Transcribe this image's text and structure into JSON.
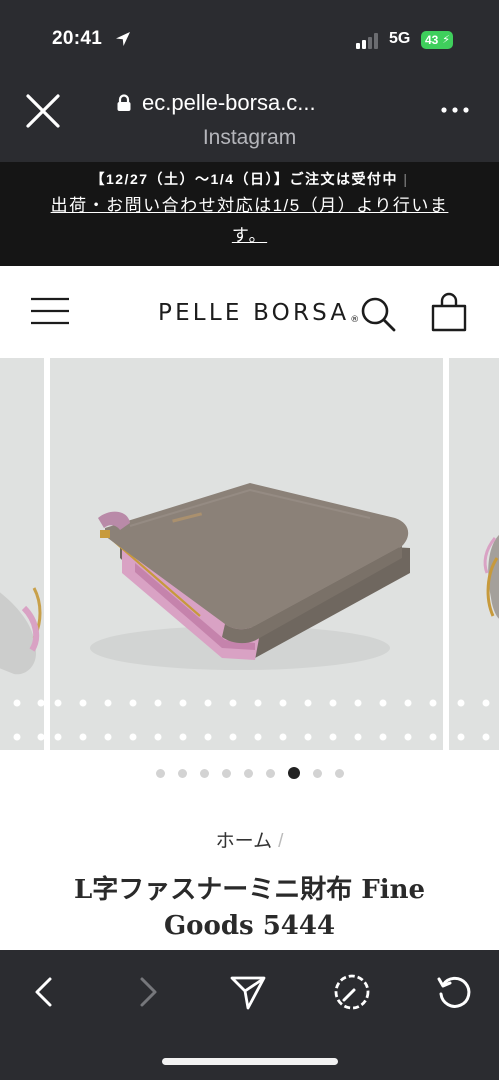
{
  "status_bar": {
    "time": "20:41",
    "network": "5G",
    "battery": "43",
    "icons": [
      "location-arrow-icon",
      "signal-bars-icon",
      "battery-charging-icon"
    ]
  },
  "browser": {
    "url": "ec.pelle-borsa.c...",
    "subtitle": "Instagram",
    "icons": [
      "close-icon",
      "lock-icon",
      "more-dots-icon"
    ]
  },
  "notice": {
    "line1": "【12/27（土）～1/4（日）】ご注文は受付中",
    "separator": "|",
    "line2": "出荷・お問い合わせ対応は1/5（月）より行います。"
  },
  "site_header": {
    "brand": "PELLE BORSA",
    "brand_mark": "®",
    "icons": [
      "hamburger-menu-icon",
      "search-icon",
      "shopping-bag-icon"
    ]
  },
  "gallery": {
    "slide_count": 9,
    "active_index": 6
  },
  "breadcrumb": {
    "home": "ホーム",
    "separator": "/"
  },
  "product": {
    "title_line1": "L字ファスナーミニ財布 Fine",
    "title_line2": "Goods 5444"
  },
  "toolbar": {
    "icons": [
      "chevron-left-icon",
      "chevron-right-icon",
      "send-icon",
      "compass-icon",
      "reload-icon"
    ]
  },
  "colors": {
    "chrome": "#2b2c30",
    "notice_bg": "#151515",
    "battery": "#3fcf5c",
    "photo_bg": "#dfe1e0",
    "wallet_leather": "#8b8178",
    "wallet_lining": "#d9a2c4"
  }
}
